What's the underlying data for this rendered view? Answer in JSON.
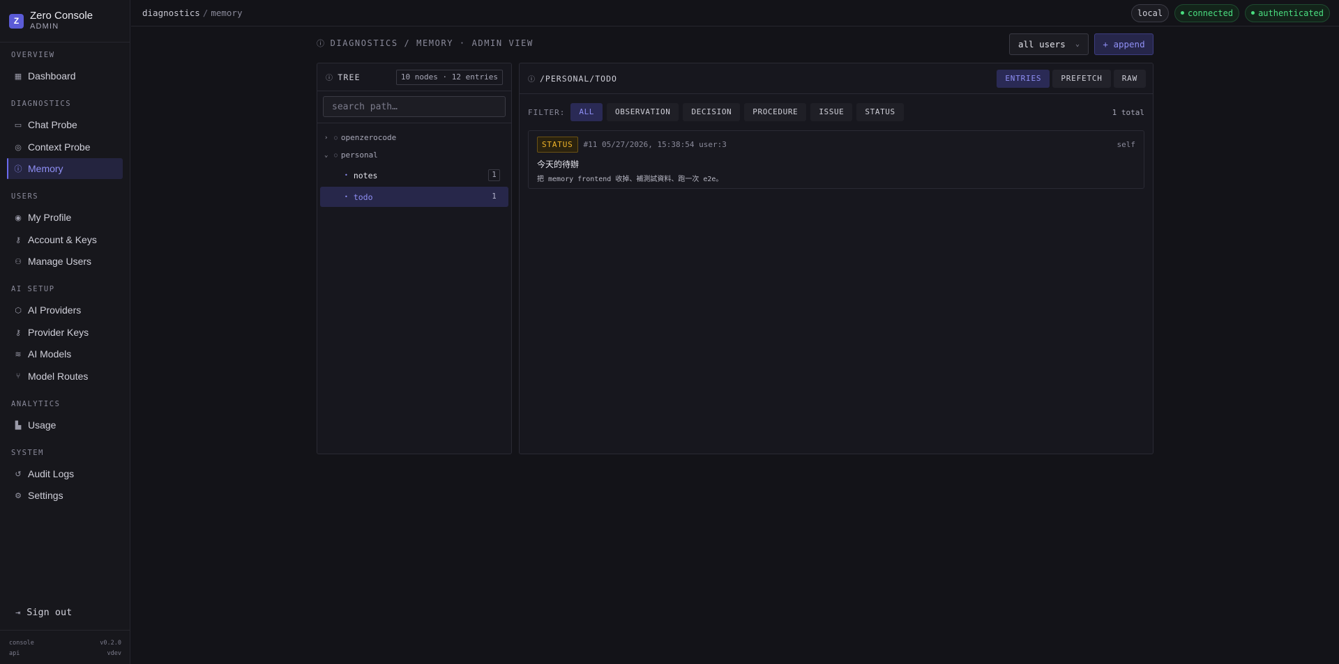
{
  "app": {
    "logo_letter": "Z",
    "name": "Zero Console",
    "role": "ADMIN"
  },
  "nav": {
    "sections": [
      {
        "label": "OVERVIEW",
        "items": [
          {
            "label": "Dashboard",
            "icon": "grid-icon"
          }
        ]
      },
      {
        "label": "DIAGNOSTICS",
        "items": [
          {
            "label": "Chat Probe",
            "icon": "chat-icon"
          },
          {
            "label": "Context Probe",
            "icon": "layers-icon"
          },
          {
            "label": "Memory",
            "icon": "memory-icon",
            "active": true
          }
        ]
      },
      {
        "label": "USERS",
        "items": [
          {
            "label": "My Profile",
            "icon": "user-circle-icon"
          },
          {
            "label": "Account & Keys",
            "icon": "key-icon"
          },
          {
            "label": "Manage Users",
            "icon": "users-icon"
          }
        ]
      },
      {
        "label": "AI SETUP",
        "items": [
          {
            "label": "AI Providers",
            "icon": "cube-icon"
          },
          {
            "label": "Provider Keys",
            "icon": "key-icon"
          },
          {
            "label": "AI Models",
            "icon": "stack-icon"
          },
          {
            "label": "Model Routes",
            "icon": "branch-icon"
          }
        ]
      },
      {
        "label": "ANALYTICS",
        "items": [
          {
            "label": "Usage",
            "icon": "bar-chart-icon"
          }
        ]
      },
      {
        "label": "SYSTEM",
        "items": [
          {
            "label": "Audit Logs",
            "icon": "history-icon"
          },
          {
            "label": "Settings",
            "icon": "gear-icon"
          }
        ]
      }
    ],
    "signout": "Sign out",
    "footer": {
      "left1": "console",
      "right1": "v0.2.0",
      "left2": "api",
      "right2": "vdev"
    }
  },
  "topbar": {
    "breadcrumb": {
      "part1": "diagnostics",
      "sep": "/",
      "part2": "memory"
    },
    "pills": {
      "env": "local",
      "conn": "connected",
      "auth": "authenticated"
    }
  },
  "header": {
    "title": "DIAGNOSTICS / MEMORY · ADMIN VIEW",
    "user_select": "all users",
    "append": "+ append"
  },
  "tree": {
    "title": "TREE",
    "count": "10 nodes · 12 entries",
    "search_placeholder": "search path…",
    "nodes": [
      {
        "label": "openzerocode",
        "caret": "›"
      },
      {
        "label": "personal",
        "caret": "⌄"
      }
    ],
    "leaves": [
      {
        "label": "notes",
        "count": "1"
      },
      {
        "label": "todo",
        "count": "1",
        "selected": true
      }
    ]
  },
  "entries": {
    "path": "/PERSONAL/TODO",
    "tabs": [
      "ENTRIES",
      "PREFETCH",
      "RAW"
    ],
    "filter_label": "FILTER:",
    "filters": [
      "ALL",
      "OBSERVATION",
      "DECISION",
      "PROCEDURE",
      "ISSUE",
      "STATUS"
    ],
    "total": "1 total",
    "items": [
      {
        "badge": "STATUS",
        "meta": "#11 05/27/2026, 15:38:54 user:3",
        "owner": "self",
        "title": "今天的待辦",
        "body": "把 memory frontend 收掉、補測試資料、跑一次 e2e。"
      }
    ]
  }
}
